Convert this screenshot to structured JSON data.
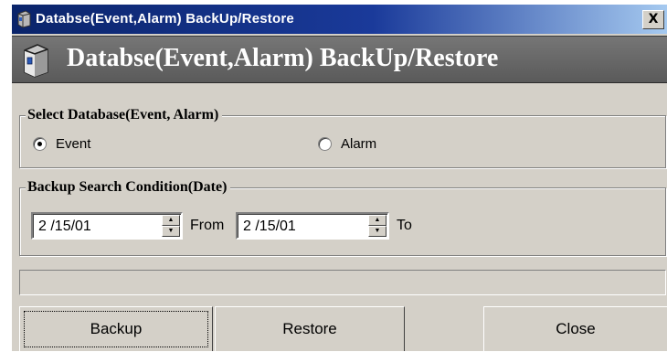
{
  "window": {
    "title": "Databse(Event,Alarm) BackUp/Restore",
    "close_label": "X"
  },
  "header": {
    "title": "Databse(Event,Alarm) BackUp/Restore",
    "icon": "database-cabinet-icon"
  },
  "select_database": {
    "legend": "Select Database(Event, Alarm)",
    "options": [
      {
        "label": "Event",
        "checked": true
      },
      {
        "label": "Alarm",
        "checked": false
      }
    ]
  },
  "backup_condition": {
    "legend": "Backup Search Condition(Date)",
    "from_date": "2 /15/01",
    "from_label": "From",
    "to_date": "2 /15/01",
    "to_label": "To"
  },
  "status": {
    "text": ""
  },
  "buttons": {
    "backup": "Backup",
    "restore": "Restore",
    "close": "Close"
  },
  "colors": {
    "titlebar_start": "#0a246a",
    "titlebar_end": "#a6caf0",
    "banner": "#6a6a6a",
    "face": "#d4d0c8"
  }
}
